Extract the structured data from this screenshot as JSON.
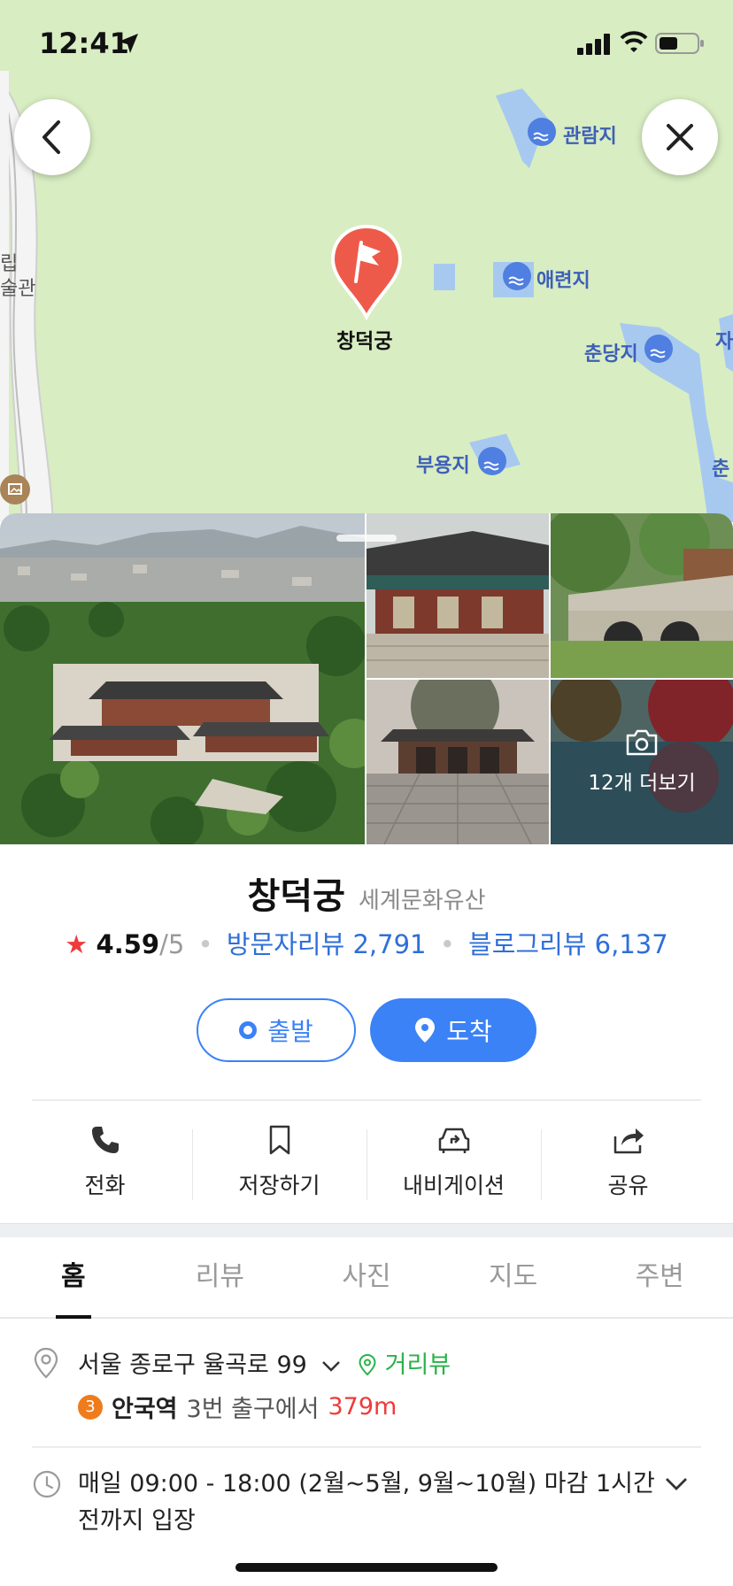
{
  "status": {
    "time": "12:41"
  },
  "map": {
    "labels": {
      "gwanramji": "관람지",
      "aeryeonji": "애련지",
      "chundangji": "춘당지",
      "buyongji": "부용지",
      "edge_left_1": "립",
      "edge_left_2": "술관",
      "edge_right_1": "자",
      "edge_right_2": "춘"
    },
    "marker_label": "창덕궁"
  },
  "photos": {
    "more_label": "12개 더보기"
  },
  "place": {
    "name": "창덕궁",
    "category": "세계문화유산",
    "rating": "4.59",
    "rating_max": "/5",
    "visitor_reviews": "방문자리뷰 2,791",
    "blog_reviews": "블로그리뷰 6,137"
  },
  "route": {
    "start_label": "출발",
    "arrive_label": "도착"
  },
  "actions": {
    "call": "전화",
    "save": "저장하기",
    "navigation": "내비게이션",
    "share": "공유"
  },
  "tabs": [
    "홈",
    "리뷰",
    "사진",
    "지도",
    "주변"
  ],
  "info": {
    "address": "서울 종로구 율곡로 99",
    "street_view": "거리뷰",
    "subway_line": "3",
    "station": "안국역",
    "exit": "3번 출구에서",
    "distance": "379m",
    "hours": "매일 09:00 - 18:00 (2월~5월, 9월~10월) 마감 1시간 전까지 입장"
  },
  "colors": {
    "accent": "#3b82f6",
    "map_bg": "#d8edc2",
    "marker": "#ee5a4a",
    "water": "#a7c9f0",
    "street_view": "#2ab24a",
    "distance": "#ee3b3b",
    "line3": "#ef7c1c"
  }
}
